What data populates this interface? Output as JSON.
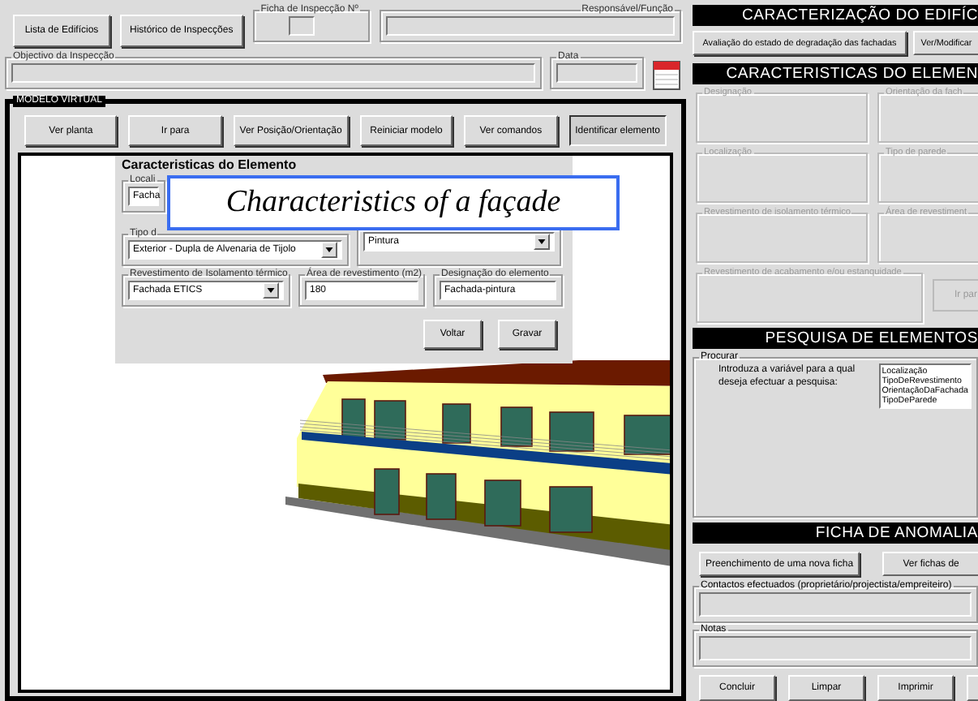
{
  "top_buttons": [
    {
      "label": "Lista de Edifícios"
    },
    {
      "label": "Histórico de Inspecções"
    }
  ],
  "inspection": {
    "number_label": "Ficha de Inspecção Nº",
    "responsible_label": "Responsável/Função",
    "objective_label": "Objectivo da Inspecção",
    "date_label": "Data"
  },
  "virtual_model": {
    "title": "MODELO VIRTUAL",
    "buttons": [
      {
        "label": "Ver planta",
        "selected": false
      },
      {
        "label": "Ir para",
        "selected": false
      },
      {
        "label": "Ver Posição/Orientação",
        "selected": false
      },
      {
        "label": "Reiniciar modelo",
        "selected": false
      },
      {
        "label": "Ver comandos",
        "selected": false
      },
      {
        "label": "Identificar elemento",
        "selected": true
      }
    ],
    "dialog": {
      "title": "Caracteristicas do Elemento",
      "fields": [
        {
          "label": "Locali",
          "kind": "text",
          "value": "Facha"
        },
        {
          "label": "Tipo d",
          "kind": "dropdown",
          "value": "Exterior - Dupla de Alvenaria de Tijolo"
        },
        {
          "kind": "dropdown",
          "value": "Pintura"
        },
        {
          "label": "Revestimento de Isolamento térmico",
          "kind": "dropdown",
          "value": "Fachada ETICS"
        },
        {
          "label": "Área de revestimento (m2)",
          "kind": "text",
          "value": "180"
        },
        {
          "label": "Designação do elemento",
          "kind": "text",
          "value": "Fachada-pintura"
        }
      ],
      "buttons": [
        {
          "label": "Voltar"
        },
        {
          "label": "Gravar"
        }
      ]
    },
    "caption": "Characteristics of a façade"
  },
  "building": {
    "title": "CARACTERIZAÇÃO DO EDIFÍC",
    "buttons": [
      {
        "label": "Avaliação do estado de degradação das fachadas"
      },
      {
        "label": "Ver/Modificar"
      }
    ]
  },
  "element": {
    "title": "CARACTERISTICAS DO ELEMEN",
    "groups": [
      {
        "label": "Designação",
        "disabled": true
      },
      {
        "label": "Orientação da fach",
        "disabled": true
      },
      {
        "label": "Localização",
        "disabled": true
      },
      {
        "label": "Tipo de parede",
        "disabled": true
      },
      {
        "label": "Revestimento de isolamento térmico",
        "disabled": true
      },
      {
        "label": "Área de revestiment",
        "disabled": true
      }
    ],
    "wide_group": {
      "label": "Revestimento de acabamento e/ou estanquidade",
      "disabled": true
    },
    "button": {
      "label": "Ir par",
      "disabled": true
    }
  },
  "search": {
    "title": "PESQUISA DE ELEMENTOS",
    "group_label": "Procurar",
    "prompt": "Introduza a variável para a qual deseja efectuar a pesquisa:",
    "options": [
      {
        "label": "Localização",
        "selected": false
      },
      {
        "label": "TipoDeRevestimento",
        "selected": false
      },
      {
        "label": "OrientaçãoDaFachada",
        "selected": false
      },
      {
        "label": "TipoDeParede",
        "selected": false
      }
    ]
  },
  "anomaly": {
    "title": "FICHA DE ANOMALIA",
    "buttons": [
      {
        "label": "Preenchimento de uma nova ficha"
      },
      {
        "label": "Ver fichas de"
      }
    ],
    "contacts_label": "Contactos efectuados (proprietário/projectista/empreiteiro)",
    "notes_label": "Notas",
    "bottom_buttons": [
      {
        "label": "Concluir"
      },
      {
        "label": "Limpar"
      },
      {
        "label": "Imprimir"
      }
    ]
  }
}
